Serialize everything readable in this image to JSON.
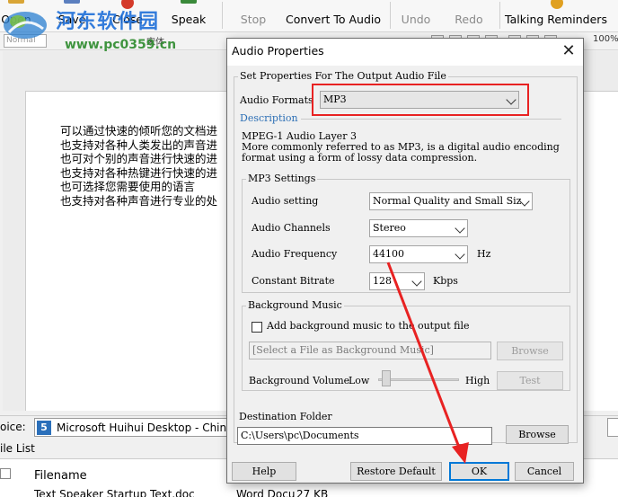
{
  "toolbar": {
    "buttons": [
      {
        "label": "Open",
        "state": "enabled"
      },
      {
        "label": "Save",
        "state": "enabled"
      },
      {
        "label": "Close",
        "state": "enabled"
      },
      {
        "label": "Speak",
        "state": "enabled"
      },
      {
        "label": "Stop",
        "state": "disabled"
      },
      {
        "label": "Convert To Audio",
        "state": "enabled"
      },
      {
        "label": "Undo",
        "state": "disabled"
      },
      {
        "label": "Redo",
        "state": "disabled"
      },
      {
        "label": "Talking Reminders",
        "state": "enabled"
      }
    ]
  },
  "watermark": {
    "title": "河东软件园",
    "url": "www.pc0359.cn"
  },
  "format_bar": {
    "style": "Normal",
    "font": "宋体",
    "zoom": "100%"
  },
  "document": {
    "lines": [
      "可以通过快速的倾听您的文档进",
      "也支持对各种人类发出的声音进",
      "也可对个别的声音进行快速的进",
      "也支持对各种热键进行快速的进",
      "也可选择您需要使用的语言",
      "也支持对各种声音进行专业的处"
    ]
  },
  "voice_bar": {
    "label": "oice:",
    "selected": "Microsoft Huihui Desktop - Chinese (Simplified)",
    "icon_glyph": "5"
  },
  "file_list": {
    "title": "ile List",
    "columns": {
      "filename": "Filename"
    },
    "rows": [
      {
        "filename": "Text Speaker Startup Text.doc",
        "type": "Word Docu",
        "size": "27 KB"
      }
    ]
  },
  "dialog": {
    "title": "Audio Properties",
    "close_glyph": "✕",
    "set_properties_group": "Set Properties For The Output Audio File",
    "audio_formats_label": "Audio Formats",
    "audio_format_value": "MP3",
    "description_label": "Description",
    "description_title": "MPEG-1 Audio Layer 3",
    "description_line1": "More commonly referred to as MP3, is a digital audio encoding",
    "description_line2": "format using a form of lossy data compression.",
    "mp3_settings_group": "MP3 Settings",
    "audio_setting_label": "Audio setting",
    "audio_setting_value": "Normal Quality and Small Size",
    "audio_channels_label": "Audio Channels",
    "audio_channels_value": "Stereo",
    "audio_frequency_label": "Audio Frequency",
    "audio_frequency_value": "44100",
    "frequency_unit": "Hz",
    "constant_bitrate_label": "Constant Bitrate",
    "bitrate_value": "128",
    "bitrate_unit": "Kbps",
    "background_music_group": "Background Music",
    "add_background_label": "Add background music to the output file",
    "background_file_placeholder": "[Select a File as Background Music]",
    "browse_label": "Browse",
    "background_volume_label": "Background Volume",
    "volume_low": "Low",
    "volume_high": "High",
    "volume_level": 0.05,
    "test_label": "Test",
    "destination_group": "Destination Folder",
    "destination_value": "C:\\Users\\pc\\Documents",
    "dest_browse_label": "Browse",
    "help_label": "Help",
    "restore_label": "Restore Default",
    "ok_label": "OK",
    "cancel_label": "Cancel"
  },
  "colors": {
    "highlight": "#e82222",
    "accent": "#0078d7",
    "watermark_blue": "#1e6fd9",
    "watermark_green": "#2c8a2c"
  }
}
